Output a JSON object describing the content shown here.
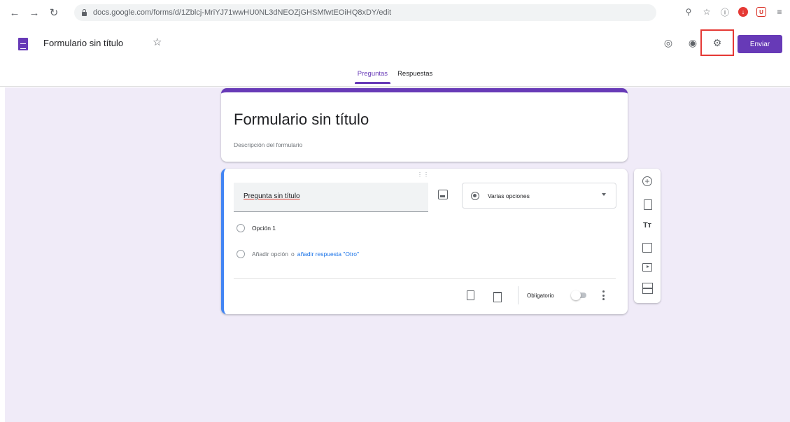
{
  "browser": {
    "back_icon": "arrow-left-icon",
    "forward_icon": "arrow-right-icon",
    "reload_icon": "reload-icon",
    "url": "docs.google.com/forms/d/1Zblcj-MriYJ71wwHU0NL3dNEOZjGHSMfwtEOiHQ8xDY/edit",
    "extension_icons": [
      "search-icon",
      "bookmark-star-icon",
      "info-icon",
      "download-icon",
      "shield-icon",
      "menu-icon"
    ]
  },
  "header": {
    "title": "Formulario sin título",
    "send_label": "Enviar",
    "accent_color": "#673ab7",
    "highlight_color": "#e53935",
    "tabs": [
      {
        "label": "Preguntas",
        "active": true
      },
      {
        "label": "Respuestas",
        "active": false
      }
    ]
  },
  "form": {
    "title": "Formulario sin título",
    "description_placeholder": "Descripción del formulario"
  },
  "question": {
    "title": "Pregunta sin título",
    "type": "Varias opciones",
    "options": [
      "Opción 1"
    ],
    "add_option": "Añadir opción",
    "or": "o",
    "add_other": "añadir respuesta \"Otro\"",
    "required_label": "Obligatorio",
    "required": false
  },
  "toolbar": {
    "title_tool_label": "Tт"
  }
}
